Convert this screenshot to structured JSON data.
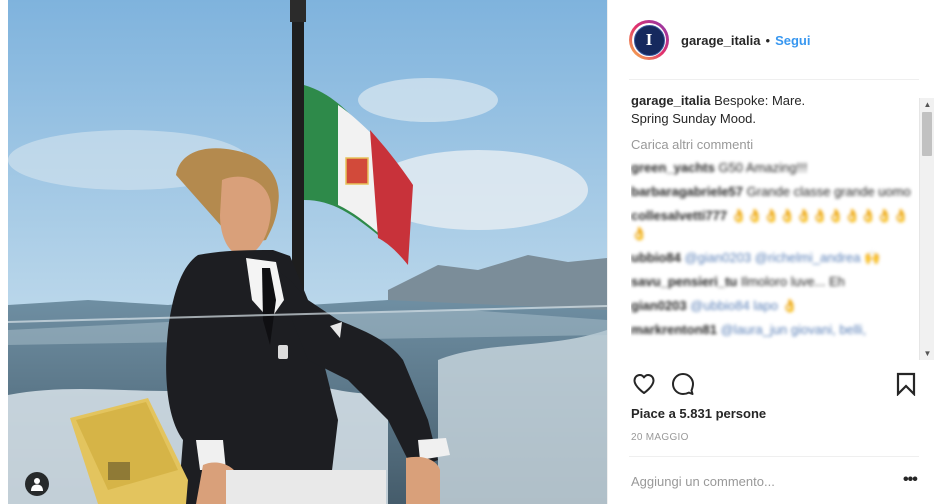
{
  "header": {
    "avatar_letter": "I",
    "username": "garage_italia",
    "separator": "•",
    "follow_label": "Segui"
  },
  "caption": {
    "username": "garage_italia",
    "line1": "Bespoke: Mare.",
    "line2": "Spring Sunday Mood."
  },
  "load_more_label": "Carica altri commenti",
  "comments": [
    {
      "user": "green_yachts",
      "text": "G50 Amazing!!!"
    },
    {
      "user": "barbaragabriele57",
      "text": "Grande classe grande uomo"
    },
    {
      "user": "collesalvetti777",
      "text": "👌👌👌👌👌👌👌👌👌👌👌👌"
    },
    {
      "user": "ubbio84",
      "text": "@gian0203 @richelmi_andrea 🙌"
    },
    {
      "user": "savu_pensieri_tu",
      "text": "Ilmoloro luve... Eh"
    },
    {
      "user": "gian0203",
      "text": "@ubbio84 lapo 👌"
    },
    {
      "user": "markrenton81",
      "text": "@laura_jun giovani, belli,"
    }
  ],
  "likes_text": "Piace a 5.831 persone",
  "date_text": "20 MAGGIO",
  "add_comment_placeholder": "Aggiungi un commento...",
  "more_label": "•••",
  "icons": {
    "like": "heart-icon",
    "comment": "comment-icon",
    "save": "bookmark-icon",
    "tag": "user-tag-icon"
  },
  "colors": {
    "follow": "#3897f0",
    "text": "#262626",
    "muted": "#999999"
  }
}
